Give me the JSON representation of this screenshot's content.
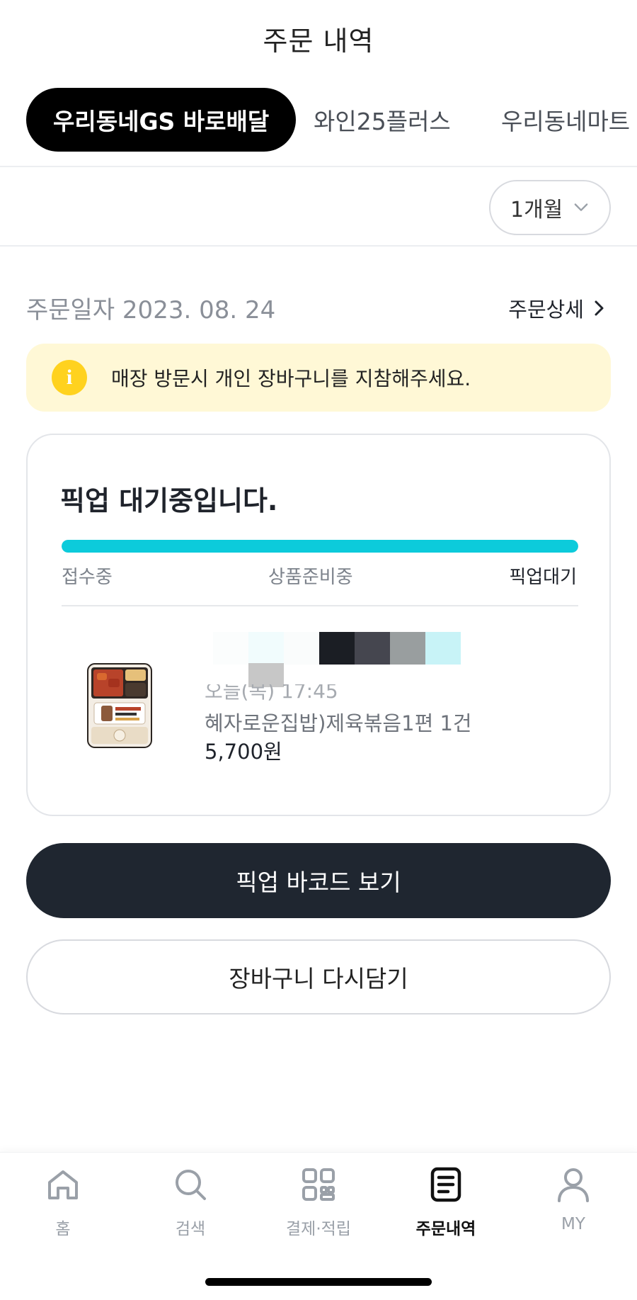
{
  "header": {
    "title": "주문 내역"
  },
  "tabs": [
    {
      "label": "우리동네GS 바로배달",
      "active": true
    },
    {
      "label": "와인25플러스",
      "active": false
    },
    {
      "label": "우리동네마트 픽업",
      "active": false
    }
  ],
  "period": {
    "selected": "1개월",
    "icon": "chevron-down-icon"
  },
  "order": {
    "date_label": "주문일자 2023. 08. 24",
    "detail_label": "주문상세"
  },
  "notice": {
    "icon": "info-icon",
    "text": "매장 방문시 개인 장바구니를 지참해주세요."
  },
  "status": {
    "title": "픽업 대기중입니다.",
    "progress": 1.0,
    "steps": [
      "접수중",
      "상품준비중",
      "픽업대기"
    ],
    "colors": {
      "progress": "#0ccbdb"
    }
  },
  "product": {
    "time_text": "오늘(목) 17:45",
    "name_text": "혜자로운집밥)제육볶음1편  1건",
    "price_text": "5,700원",
    "redaction_colors": [
      "#fbfdfd",
      "#f1fcfd",
      "#fafcfc",
      "#1b1e24",
      "#45464f",
      "#999e9f",
      "#c8f3f7"
    ]
  },
  "buttons": {
    "barcode_label": "픽업 바코드 보기",
    "recart_label": "장바구니 다시담기"
  },
  "nav": [
    {
      "label": "홈",
      "icon": "home-icon",
      "active": false
    },
    {
      "label": "검색",
      "icon": "search-icon",
      "active": false
    },
    {
      "label": "결제·적립",
      "icon": "qr-pay-icon",
      "active": false
    },
    {
      "label": "주문내역",
      "icon": "order-list-icon",
      "active": true
    },
    {
      "label": "MY",
      "icon": "profile-icon",
      "active": false
    }
  ]
}
